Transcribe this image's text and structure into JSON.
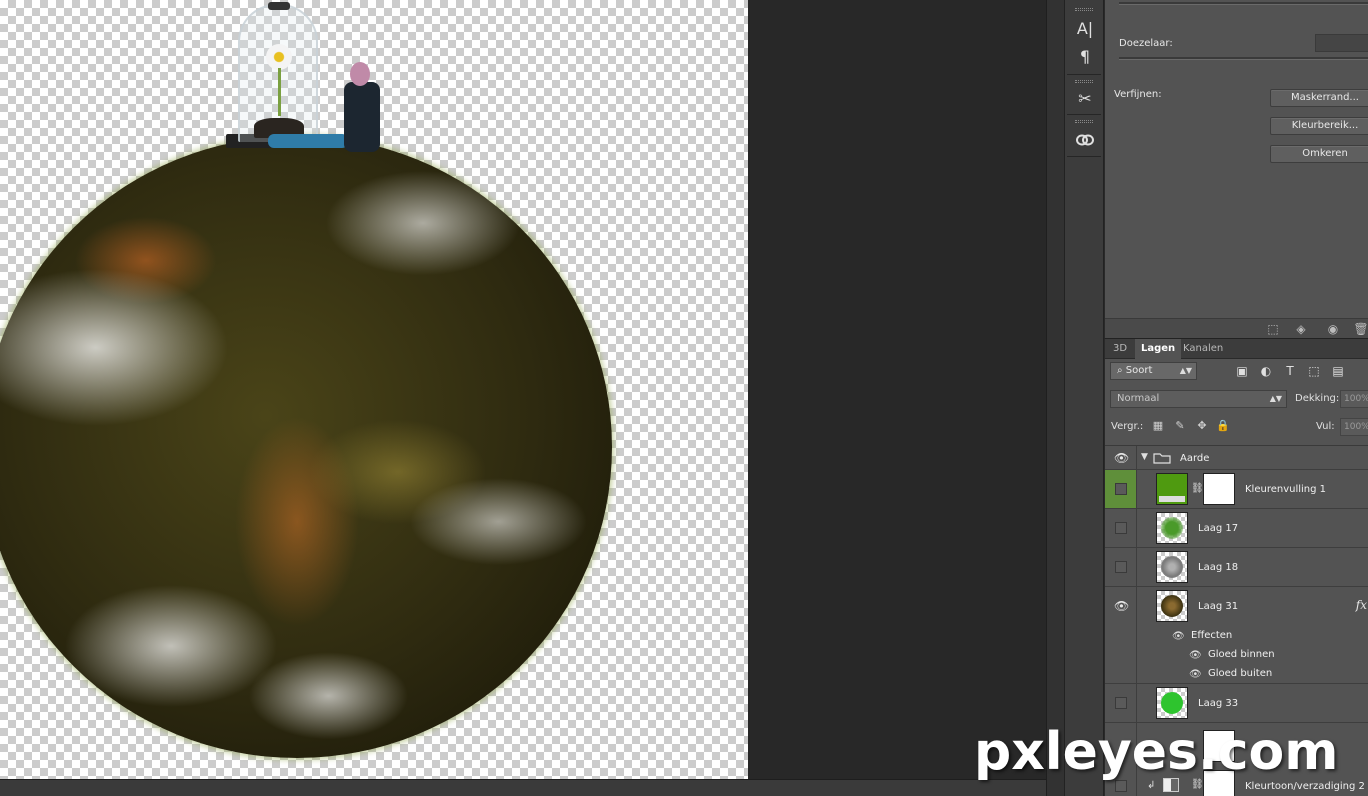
{
  "properties": {
    "target_label": "Doezelaar:",
    "refine_label": "Verfijnen:",
    "buttons": {
      "mask_edge": "Maskerrand...",
      "color_range": "Kleurbereik...",
      "invert": "Omkeren"
    }
  },
  "layers_panel": {
    "tabs": [
      "3D",
      "Lagen",
      "Kanalen"
    ],
    "active_tab": "Lagen",
    "filter": {
      "kind_label": "Soort"
    },
    "blend_mode": "Normaal",
    "opacity_label": "Dekking:",
    "opacity_value": "100%",
    "lock_label": "Vergr.:",
    "fill_label": "Vul:",
    "fill_value": "100%",
    "group": {
      "name": "Aarde"
    },
    "layers": [
      {
        "name": "Kleurenvulling 1",
        "visible": false,
        "selected": true,
        "thumb_color": "#4f9a10"
      },
      {
        "name": "Laag 17",
        "visible": false,
        "thumb_color": "#4a9a2a"
      },
      {
        "name": "Laag 18",
        "visible": false,
        "thumb_color": "#9a9a9a"
      },
      {
        "name": "Laag 31",
        "visible": true,
        "thumb_color": "#5a4a20",
        "fx": "fx",
        "effects_label": "Effecten",
        "effects": [
          "Gloed binnen",
          "Gloed buiten"
        ]
      },
      {
        "name": "Laag 33",
        "visible": false,
        "thumb_color": "#2ec42e"
      },
      {
        "name": "Kleurtoon/verzadiging 2",
        "visible": false
      }
    ]
  },
  "watermark": "pxleyes.com",
  "colors": {
    "selected_row": "#5f8f3a",
    "panel_bg": "#535353",
    "workspace_bg": "#282828"
  },
  "icons": {
    "tool_strip": [
      "character-icon",
      "paragraph-icon",
      "brush-settings-icon",
      "creative-cloud-icon"
    ]
  }
}
